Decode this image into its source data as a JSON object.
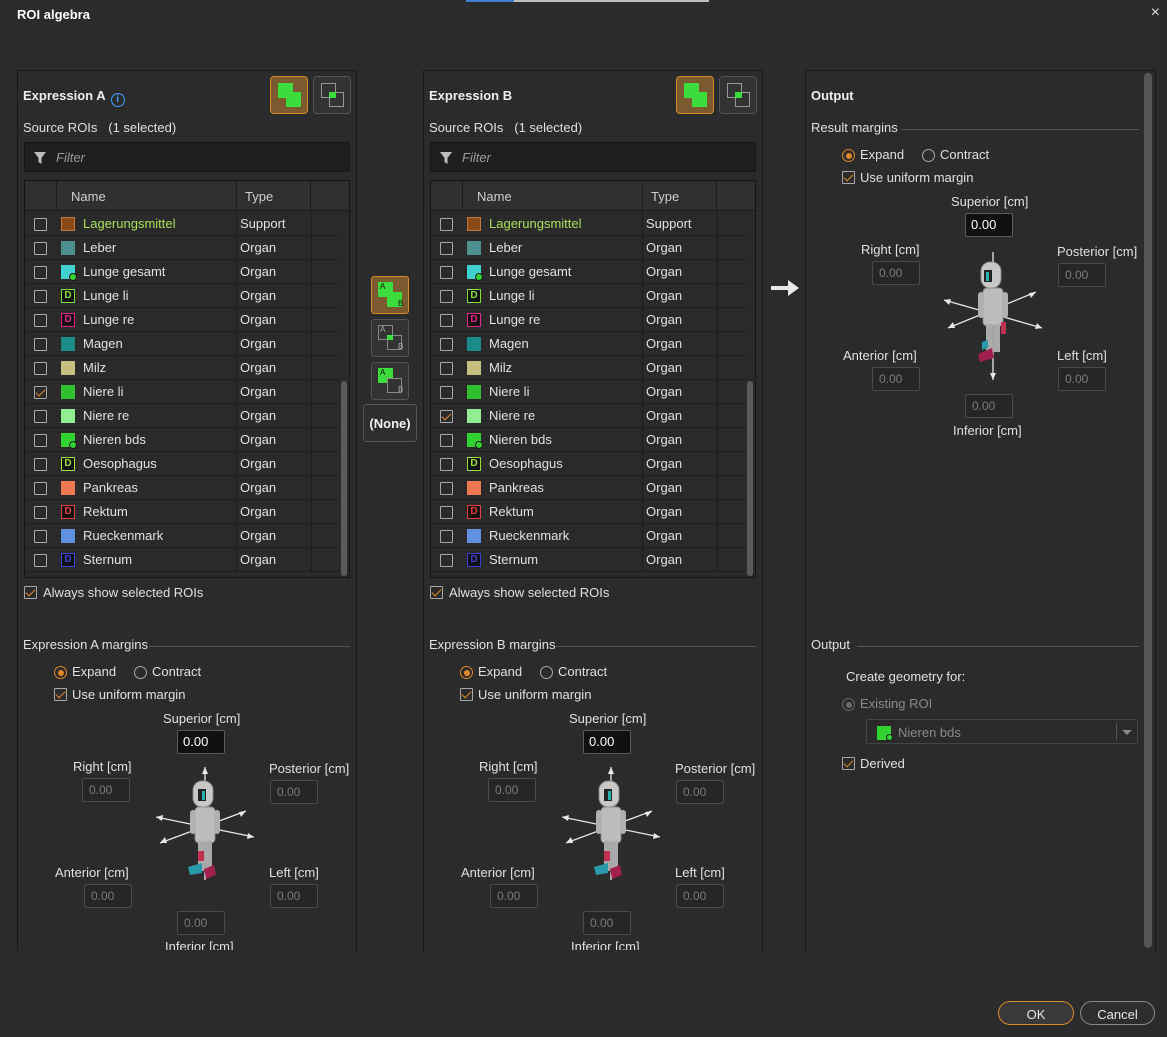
{
  "window": {
    "title": "ROI algebra",
    "close_icon": "×"
  },
  "exprA": {
    "title": "Expression A",
    "info_icon": "i",
    "source_label": "Source ROIs",
    "selected_count": "(1 selected)",
    "filter_placeholder": "Filter",
    "col_name": "Name",
    "col_type": "Type",
    "always_show": "Always show selected ROIs",
    "margins_title": "Expression A margins",
    "expand": "Expand",
    "contract": "Contract",
    "uniform": "Use uniform margin",
    "superior": "Superior [cm]",
    "right": "Right [cm]",
    "posterior": "Posterior [cm]",
    "anterior": "Anterior [cm]",
    "left": "Left [cm]",
    "inferior": "Inferior [cm]",
    "v_superior": "0.00",
    "v_right": "0.00",
    "v_posterior": "0.00",
    "v_anterior": "0.00",
    "v_left": "0.00",
    "v_inferior": "0.00",
    "checked_index": 7
  },
  "exprB": {
    "title": "Expression B",
    "source_label": "Source ROIs",
    "selected_count": "(1 selected)",
    "filter_placeholder": "Filter",
    "col_name": "Name",
    "col_type": "Type",
    "always_show": "Always show selected ROIs",
    "margins_title": "Expression B margins",
    "expand": "Expand",
    "contract": "Contract",
    "uniform": "Use uniform margin",
    "superior": "Superior [cm]",
    "right": "Right [cm]",
    "posterior": "Posterior [cm]",
    "anterior": "Anterior [cm]",
    "left": "Left [cm]",
    "inferior": "Inferior [cm]",
    "v_superior": "0.00",
    "v_right": "0.00",
    "v_posterior": "0.00",
    "v_anterior": "0.00",
    "v_left": "0.00",
    "v_inferior": "0.00",
    "checked_index": 8
  },
  "rois": [
    {
      "name": "Lagerungsmittel",
      "type": "Support",
      "color": "#8a4a1a",
      "outline": "#c47a3a",
      "glyph": ""
    },
    {
      "name": "Leber",
      "type": "Organ",
      "color": "#4f8f8f",
      "glyph": ""
    },
    {
      "name": "Lunge gesamt",
      "type": "Organ",
      "color": "#3fd0d0",
      "glyph": "dot"
    },
    {
      "name": "Lunge li",
      "type": "Organ",
      "color": "#7fe03a",
      "glyph": "D"
    },
    {
      "name": "Lunge re",
      "type": "Organ",
      "color": "#e0288a",
      "glyph": "D"
    },
    {
      "name": "Magen",
      "type": "Organ",
      "color": "#1a8a8a",
      "glyph": ""
    },
    {
      "name": "Milz",
      "type": "Organ",
      "color": "#c8c080",
      "glyph": ""
    },
    {
      "name": "Niere li",
      "type": "Organ",
      "color": "#32c032",
      "glyph": ""
    },
    {
      "name": "Niere re",
      "type": "Organ",
      "color": "#90ee90",
      "glyph": ""
    },
    {
      "name": "Nieren bds",
      "type": "Organ",
      "color": "#32d232",
      "glyph": "dot"
    },
    {
      "name": "Oesophagus",
      "type": "Organ",
      "color": "#9ae03a",
      "glyph": "D"
    },
    {
      "name": "Pankreas",
      "type": "Organ",
      "color": "#f07850",
      "glyph": ""
    },
    {
      "name": "Rektum",
      "type": "Organ",
      "color": "#e04040",
      "glyph": "D"
    },
    {
      "name": "Rueckenmark",
      "type": "Organ",
      "color": "#6090e0",
      "glyph": ""
    },
    {
      "name": "Sternum",
      "type": "Organ",
      "color": "#4040d0",
      "glyph": "D"
    }
  ],
  "ops": {
    "none_label": "(None)",
    "a_letter": "A",
    "b_letter": "B"
  },
  "output": {
    "title": "Output",
    "result_margins": "Result margins",
    "expand": "Expand",
    "contract": "Contract",
    "uniform": "Use uniform margin",
    "superior": "Superior [cm]",
    "right": "Right [cm]",
    "posterior": "Posterior [cm]",
    "anterior": "Anterior [cm]",
    "left": "Left [cm]",
    "inferior": "Inferior [cm]",
    "v_superior": "0.00",
    "v_right": "0.00",
    "v_posterior": "0.00",
    "v_anterior": "0.00",
    "v_left": "0.00",
    "v_inferior": "0.00",
    "section_title": "Output",
    "create_for": "Create geometry for:",
    "existing_roi": "Existing ROI",
    "selected_roi": "Nieren bds",
    "derived": "Derived"
  },
  "buttons": {
    "ok": "OK",
    "cancel": "Cancel"
  },
  "colors": {
    "accent": "#e0892b",
    "info": "#3fa0ff",
    "roi_highlight": "#a8e05a"
  }
}
